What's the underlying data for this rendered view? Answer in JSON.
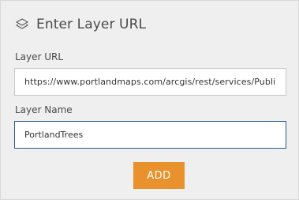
{
  "header": {
    "icon": "layers-icon",
    "title": "Enter Layer URL"
  },
  "form": {
    "url_label": "Layer URL",
    "url_value": "https://www.portlandmaps.com/arcgis/rest/services/Publi",
    "name_label": "Layer Name",
    "name_value": "PortlandTrees",
    "add_label": "ADD"
  },
  "colors": {
    "accent": "#e8912d",
    "panel_bg": "#efefef",
    "focus_border": "#2a5a8a"
  }
}
